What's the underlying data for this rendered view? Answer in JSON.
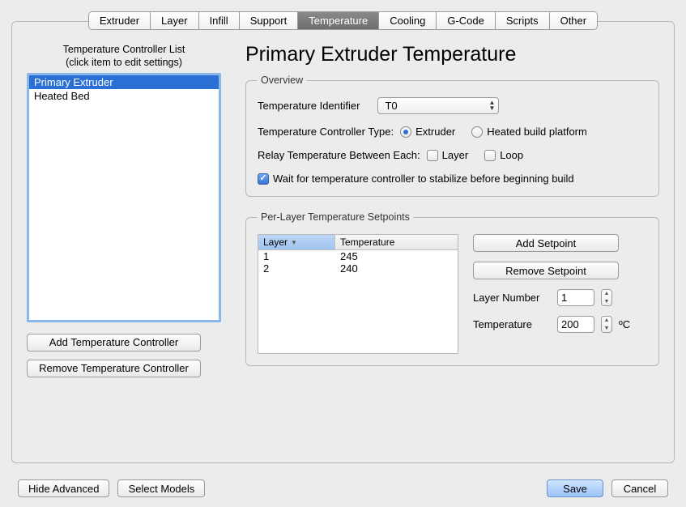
{
  "tabs": [
    "Extruder",
    "Layer",
    "Infill",
    "Support",
    "Temperature",
    "Cooling",
    "G-Code",
    "Scripts",
    "Other"
  ],
  "active_tab_index": 4,
  "controller_list": {
    "title_line1": "Temperature Controller List",
    "title_line2": "(click item to edit settings)",
    "items": [
      "Primary Extruder",
      "Heated Bed"
    ],
    "selected_index": 0,
    "add_label": "Add Temperature Controller",
    "remove_label": "Remove Temperature Controller"
  },
  "page_title": "Primary Extruder Temperature",
  "overview": {
    "legend": "Overview",
    "identifier_label": "Temperature Identifier",
    "identifier_value": "T0",
    "type_label": "Temperature Controller Type:",
    "type_option_extruder": "Extruder",
    "type_option_platform": "Heated build platform",
    "relay_label": "Relay Temperature Between Each:",
    "relay_layer": "Layer",
    "relay_loop": "Loop",
    "wait_label": "Wait for temperature controller to stabilize before beginning build"
  },
  "setpoints": {
    "legend": "Per-Layer Temperature Setpoints",
    "col_layer": "Layer",
    "col_temp": "Temperature",
    "rows": [
      {
        "layer": "1",
        "temp": "245"
      },
      {
        "layer": "2",
        "temp": "240"
      }
    ],
    "add_label": "Add Setpoint",
    "remove_label": "Remove Setpoint",
    "layer_num_label": "Layer Number",
    "layer_num_value": "1",
    "temp_label": "Temperature",
    "temp_value": "200",
    "temp_unit": "ºC"
  },
  "buttons": {
    "hide_advanced": "Hide Advanced",
    "select_models": "Select Models",
    "save": "Save",
    "cancel": "Cancel"
  }
}
